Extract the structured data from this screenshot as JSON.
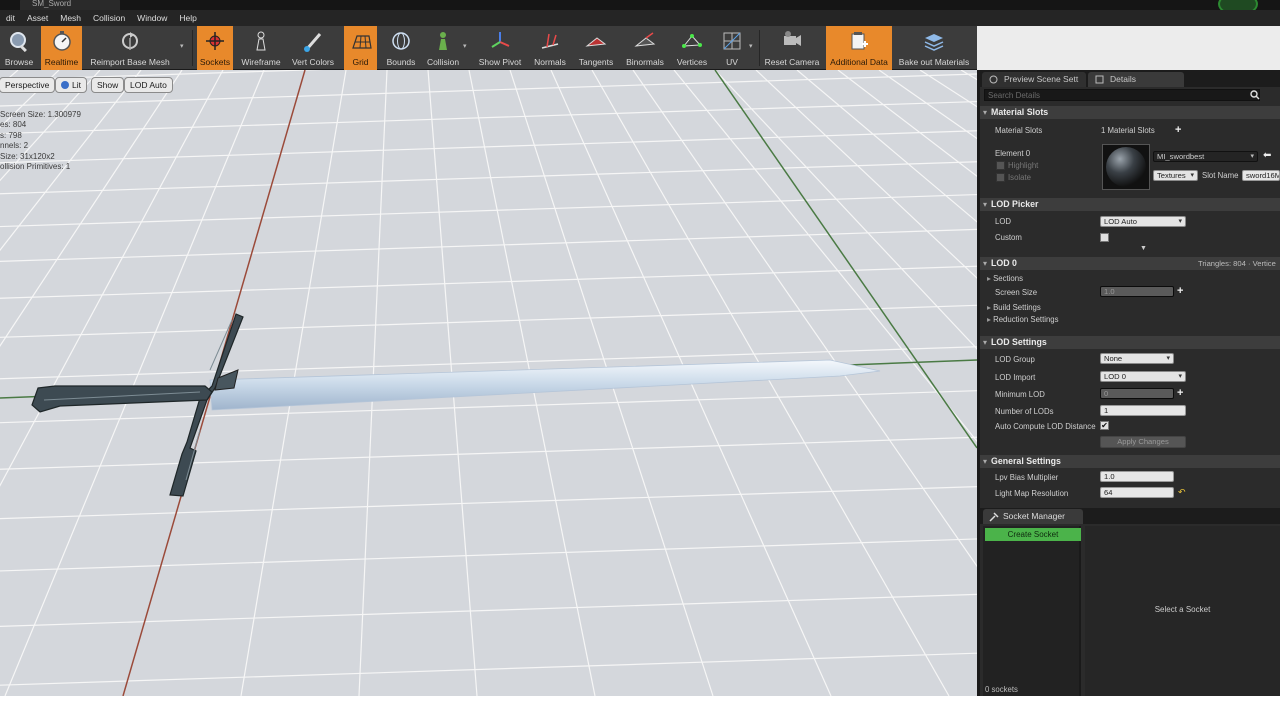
{
  "window": {
    "title": "SM_Sword"
  },
  "menu": [
    "dit",
    "Asset",
    "Mesh",
    "Collision",
    "Window",
    "Help"
  ],
  "toolbar": {
    "buttons": [
      {
        "label": "Browse",
        "icon": "magnifier-icon",
        "active": false
      },
      {
        "label": "Realtime",
        "icon": "stopwatch-icon",
        "active": true
      },
      {
        "label": "Reimport Base Mesh",
        "icon": "reimport-icon",
        "active": false
      },
      {
        "label": "Sockets",
        "icon": "sockets-icon",
        "active": true
      },
      {
        "label": "Wireframe",
        "icon": "wireframe-pawn-icon",
        "active": false
      },
      {
        "label": "Vert Colors",
        "icon": "paintbrush-icon",
        "active": false
      },
      {
        "label": "Grid",
        "icon": "grid-icon",
        "active": true
      },
      {
        "label": "Bounds",
        "icon": "bounds-sphere-icon",
        "active": false
      },
      {
        "label": "Collision",
        "icon": "collision-pawn-icon",
        "active": false
      },
      {
        "label": "Show Pivot",
        "icon": "pivot-axes-icon",
        "active": false
      },
      {
        "label": "Normals",
        "icon": "normals-icon",
        "active": false
      },
      {
        "label": "Tangents",
        "icon": "tangents-icon",
        "active": false
      },
      {
        "label": "Binormals",
        "icon": "binormals-icon",
        "active": false
      },
      {
        "label": "Vertices",
        "icon": "vertices-icon",
        "active": false
      },
      {
        "label": "UV",
        "icon": "uv-grid-icon",
        "active": false
      },
      {
        "label": "Reset Camera",
        "icon": "camera-icon",
        "active": false
      },
      {
        "label": "Additional Data",
        "icon": "additional-data-icon",
        "active": true
      },
      {
        "label": "Bake out Materials",
        "icon": "layers-icon",
        "active": false
      }
    ]
  },
  "viewport": {
    "buttons": {
      "perspective": "Perspective",
      "lit": "Lit",
      "show": "Show",
      "lod": "LOD Auto"
    },
    "stats": [
      "Screen Size: 1.300979",
      "es: 804",
      "s: 798",
      "nnels: 2",
      "Size: 31x120x2",
      "ollision Primitives: 1"
    ]
  },
  "details": {
    "tabs": {
      "preview": "Preview Scene Sett",
      "details": "Details"
    },
    "search_placeholder": "Search Details",
    "material_slots": {
      "header": "Material Slots",
      "label": "Material Slots",
      "count": "1 Material Slots",
      "element": "Element 0",
      "highlight": "Highlight",
      "isolate": "Isolate",
      "material": "MI_swordbest",
      "textures": "Textures",
      "slot_name_label": "Slot Name",
      "slot_name": "sword16M"
    },
    "lod_picker": {
      "header": "LOD Picker",
      "lod_label": "LOD",
      "lod_value": "LOD Auto",
      "custom_label": "Custom"
    },
    "lod0": {
      "header": "LOD 0",
      "stats": "Triangles: 804 · Vertice",
      "sections": "Sections",
      "screen_size_label": "Screen Size",
      "screen_size": "1.0",
      "build_settings": "Build Settings",
      "reduction_settings": "Reduction Settings"
    },
    "lod_settings": {
      "header": "LOD Settings",
      "group_label": "LOD Group",
      "group": "None",
      "import_label": "LOD Import",
      "import": "LOD 0",
      "min_lod_label": "Minimum LOD",
      "min_lod": "0",
      "num_lods_label": "Number of LODs",
      "num_lods": "1",
      "auto_compute_label": "Auto Compute LOD Distance",
      "auto_compute_checked": true,
      "apply": "Apply Changes"
    },
    "general": {
      "header": "General Settings",
      "lpv_label": "Lpv Bias Multiplier",
      "lpv": "1.0",
      "lightmap_label": "Light Map Resolution",
      "lightmap": "64"
    }
  },
  "socket_manager": {
    "title": "Socket Manager",
    "create": "Create Socket",
    "count": "0 sockets",
    "empty": "Select a Socket"
  },
  "colors": {
    "accent_active": "#e8892b",
    "create_socket": "#4bb34a",
    "viewport_bg": "#d4d7dc"
  }
}
